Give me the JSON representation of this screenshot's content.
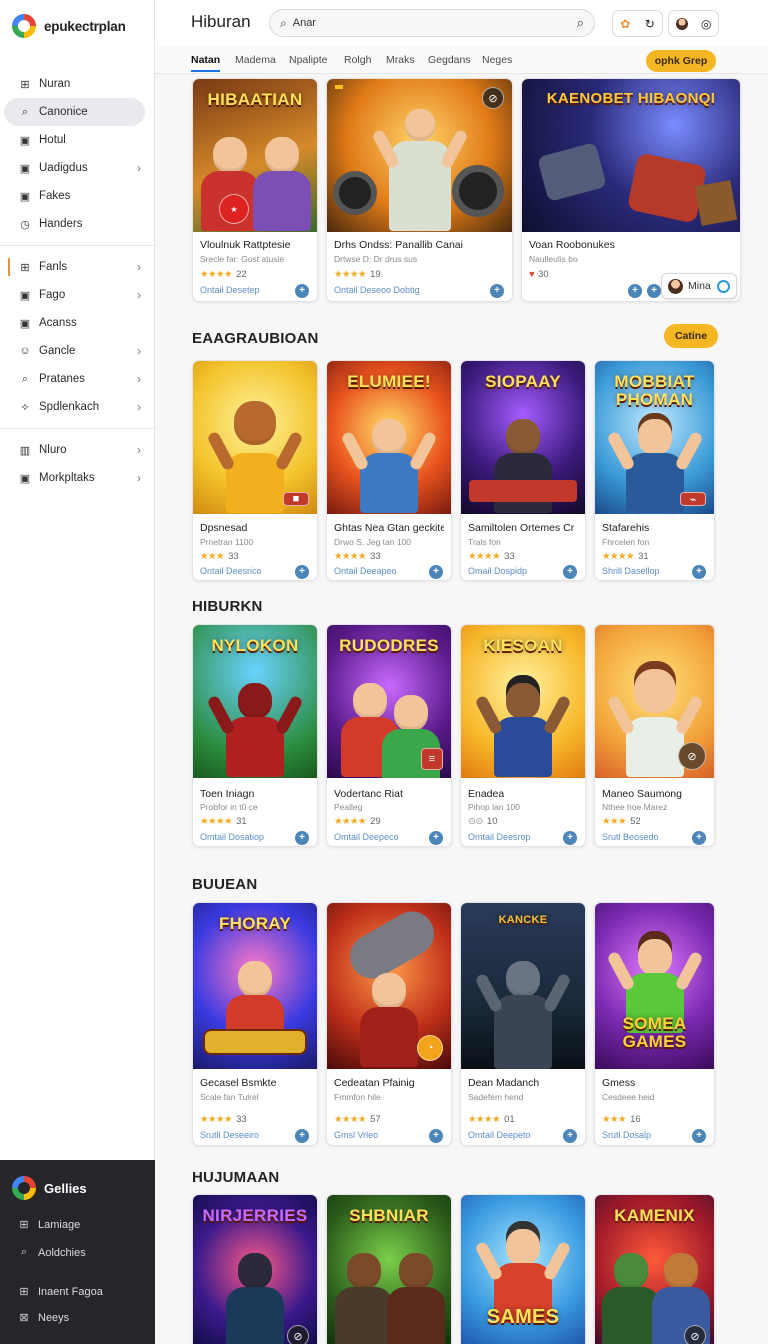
{
  "app": {
    "brand": "epukectrplan"
  },
  "header": {
    "title": "Hiburan",
    "search_value": "Anar",
    "tabs": [
      "Natan",
      "Madema",
      "Npalipte",
      "Rolgh",
      "Mraks",
      "Gegdans",
      "Neges"
    ],
    "pill_top": "ophk Grep",
    "pill_section": "Catine"
  },
  "sidebar": {
    "items": [
      {
        "label": "Nuran",
        "icon": "grid-icon"
      },
      {
        "label": "Canonice",
        "icon": "search-icon"
      },
      {
        "label": "Hotul",
        "icon": "calendar-icon"
      },
      {
        "label": "Uadigdus",
        "icon": "calendar-icon"
      },
      {
        "label": "Fakes",
        "icon": "calendar-icon"
      },
      {
        "label": "Handers",
        "icon": "clock-icon"
      },
      {
        "label": "Fanls",
        "icon": "grid-icon"
      },
      {
        "label": "Fago",
        "icon": "calendar-icon"
      },
      {
        "label": "Acanss",
        "icon": "calendar-icon"
      },
      {
        "label": "Gancle",
        "icon": "user-icon"
      },
      {
        "label": "Pratanes",
        "icon": "search-icon"
      },
      {
        "label": "Spdlenkach",
        "icon": "sparkle-icon"
      },
      {
        "label": "Nluro",
        "icon": "chart-icon"
      },
      {
        "label": "Morkpltaks",
        "icon": "calendar-icon"
      }
    ]
  },
  "dock": {
    "title": "Gellies",
    "items": [
      {
        "label": "Lamiage",
        "icon": "grid-icon"
      },
      {
        "label": "Aoldchies",
        "icon": "search-icon"
      },
      {
        "label": "Inaent Fagoa",
        "icon": "grid-icon"
      },
      {
        "label": "Neeys",
        "icon": "cross-grid-icon"
      }
    ]
  },
  "featured": [
    {
      "art": "HIBAATIAN",
      "title": "Vloulnuk Rattptesie",
      "sub": "Srecle far: Gost atusie",
      "rating": "22",
      "link": "Ontail Desetep"
    },
    {
      "art": "",
      "title": "Drhs Ondss: Panallib Canai",
      "sub": "Drtwse D: Dr drus sus",
      "rating": "19",
      "link": "Ontail Deseoo Dobtig"
    },
    {
      "art": "KAENOBET HIBAONQI",
      "title": "Voan Roobonukes",
      "sub": "Naulleulis bo",
      "rating": "30",
      "link": ""
    }
  ],
  "profile": {
    "name": "Mina"
  },
  "sections": [
    {
      "title": "EAAGRAUBIOAN",
      "cards": [
        {
          "art": "",
          "title": "Dpsnesad",
          "sub": "Prnetran 1100",
          "rating": "33",
          "link": "Ontail Deesrico"
        },
        {
          "art": "ELUMIEE!",
          "title": "Ghtas Nea Gtan geckite",
          "sub": "Drwo S. Jeg tan 100",
          "rating": "33",
          "link": "Ontail Deeapeo"
        },
        {
          "art": "SIOPAAY",
          "title": "Samiltolen Ortemes Cr",
          "sub": "Trals fon",
          "rating": "33",
          "link": "Omail Dospidp"
        },
        {
          "art": "MOBBIAT PHOMAN",
          "title": "Stafarehis",
          "sub": "Fhrcelen fon",
          "rating": "31",
          "link": "Shrill Dasellop"
        }
      ]
    },
    {
      "title": "HIBURKN",
      "cards": [
        {
          "art": "NYLOKON",
          "title": "Toen Iniagn",
          "sub": "Probfor in t0 ce",
          "rating": "31",
          "link": "Omtail Dosatiop"
        },
        {
          "art": "RUDODRES",
          "title": "Vodertanc Riat",
          "sub": "Pealleg",
          "rating": "29",
          "link": "Omtail Deepeco"
        },
        {
          "art": "KIESOAN",
          "title": "Enadea",
          "sub": "Pihop lan 100",
          "rating": "10",
          "link": "Omtail Deesrop"
        },
        {
          "art": "",
          "title": "Maneo Saumong",
          "sub": "Nthee hoe Marez",
          "rating": "52",
          "link": "Srutl Beosedo"
        }
      ]
    },
    {
      "title": "BUUEAN",
      "cards": [
        {
          "art": "FHORAY",
          "title": "Gecasel Bsmkte",
          "sub": "Scale fan Tulrel",
          "rating": "33",
          "link": "Srutll Deseeiro"
        },
        {
          "art": "",
          "title": "Cedeatan Pfainig",
          "sub": "Fmmfon hile",
          "rating": "57",
          "link": "Gmsl Vrleo"
        },
        {
          "art": "KANCKE",
          "title": "Dean Madanch",
          "sub": "Sadefem hend",
          "rating": "01",
          "link": "Omtail Deepeto"
        },
        {
          "art": "SOMEA GAMES",
          "title": "Gmess",
          "sub": "Cesdeee heid",
          "rating": "16",
          "link": "Srutl Dosalp"
        }
      ]
    },
    {
      "title": "HUJUMAAN",
      "cards": [
        {
          "art": "NIRJERRIES",
          "title": "",
          "sub": "",
          "rating": "",
          "link": ""
        },
        {
          "art": "SHBNIAR",
          "title": "",
          "sub": "",
          "rating": "",
          "link": ""
        },
        {
          "art": "SAMES",
          "title": "",
          "sub": "",
          "rating": "",
          "link": ""
        },
        {
          "art": "KAMENIX",
          "title": "",
          "sub": "",
          "rating": "",
          "link": ""
        }
      ]
    }
  ]
}
